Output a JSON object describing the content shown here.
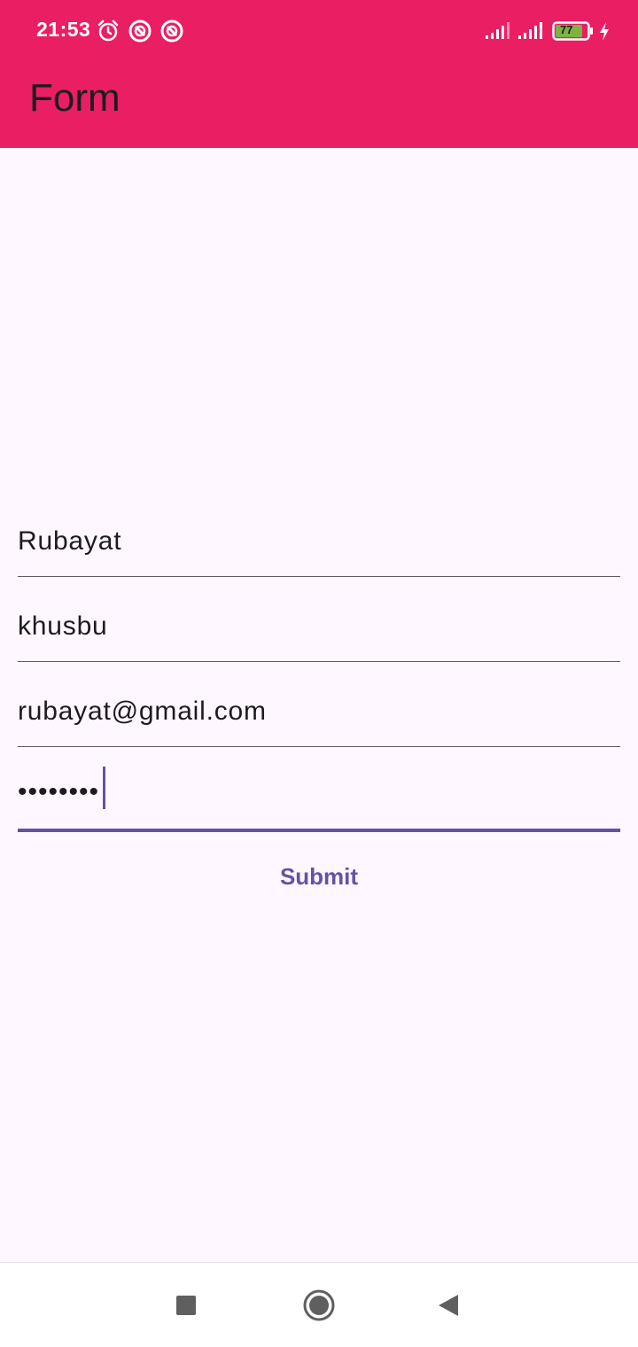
{
  "status_bar": {
    "time": "21:53",
    "battery_level": "77",
    "icons": [
      "alarm-icon",
      "do-not-disturb-icon",
      "do-not-disturb-icon",
      "signal-icon",
      "signal-icon",
      "battery-icon",
      "charging-icon"
    ],
    "colors": {
      "bar": "#e91e63",
      "battery_fill": "#7cb342"
    }
  },
  "app_bar": {
    "title": "Form"
  },
  "form": {
    "fields": [
      {
        "value": "Rubayat"
      },
      {
        "value": "khusbu"
      },
      {
        "value": "rubayat@gmail.com"
      },
      {
        "value": "••••••••",
        "type": "password",
        "focused": true
      }
    ],
    "submit_label": "Submit",
    "accent_color": "#6750a4"
  },
  "nav_bar": {
    "buttons": [
      "recents-icon",
      "home-icon",
      "back-icon"
    ]
  }
}
